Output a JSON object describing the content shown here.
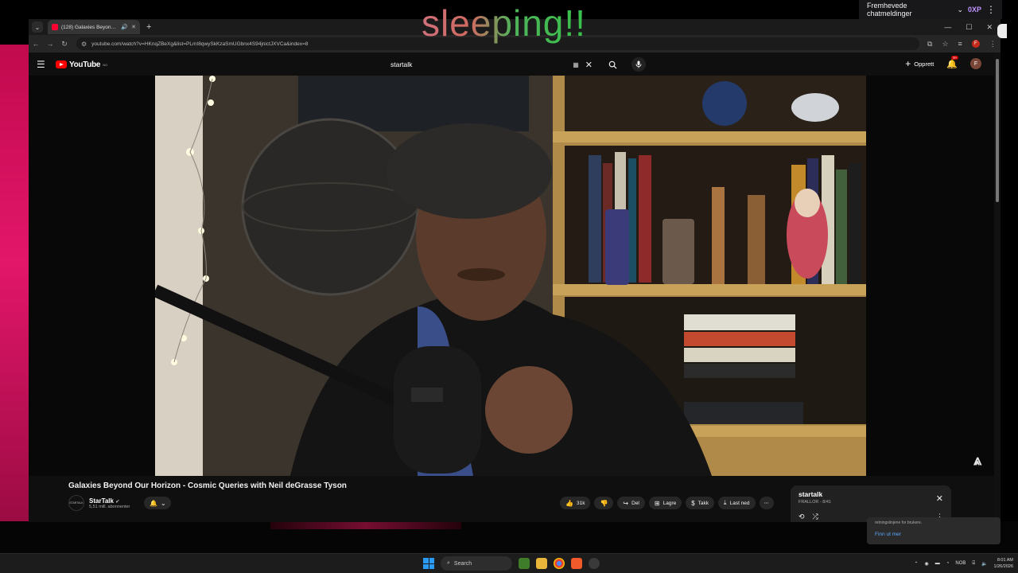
{
  "overlay": {
    "text": "sleeping!!"
  },
  "stream_popup": {
    "label": "Fremhevede chatmeldinger",
    "points": "0XP"
  },
  "tab": {
    "title": "(128) Galaxies Beyond Our Horizon - Cosmic Queries with Neil deGrasse Tyson"
  },
  "address_bar": {
    "url": "youtube.com/watch?v=HKnqZBeXg&list=PLmI8qwySkKzaSmUGbnx4S94jnictJXVCa&index=8"
  },
  "youtube": {
    "logo": "YouTube",
    "logo_region": "NO",
    "search": {
      "query": "startalk"
    },
    "create_label": "Opprett",
    "notification_count": "9+",
    "user_initial": "F"
  },
  "video": {
    "title": "Galaxies Beyond Our Horizon - Cosmic Queries with Neil deGrasse Tyson",
    "channel": {
      "name": "StarTalk",
      "avatar_text": "STARTALK",
      "subscribers": "5,51 mill. abonnenter"
    }
  },
  "actions": {
    "likes": "31k",
    "share": "Del",
    "save": "Lagre",
    "thanks": "Takk",
    "download": "Last ned"
  },
  "playlist": {
    "title": "startalk",
    "subtitle": "FRALLOR - 8/41"
  },
  "notification": {
    "text": "retningslinjene for brukere.",
    "link": "Finn ut mer"
  },
  "taskbar": {
    "search_label": "Search",
    "lang": "NOB",
    "time": "8:01 AM",
    "date": "1/26/2026"
  },
  "colors": {
    "youtube_red": "#ff0000",
    "accent_blue": "#3ea6ff",
    "wallpaper_pink": "#e3166a"
  },
  "icons": [
    "search-icon",
    "mic-icon",
    "bell-icon",
    "like-icon",
    "dislike-icon",
    "share-icon",
    "save-icon",
    "thanks-icon",
    "download-icon",
    "close-icon",
    "loop-icon",
    "shuffle-icon"
  ]
}
